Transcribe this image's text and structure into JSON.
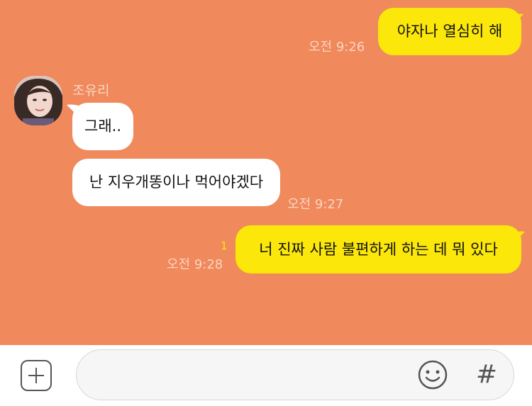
{
  "messages": [
    {
      "side": "mine",
      "text": "야자나 열심히 해",
      "time": "오전 9:26"
    },
    {
      "side": "theirs",
      "sender": "조유리",
      "text": "그래.."
    },
    {
      "side": "theirs",
      "text": "난 지우개똥이나 먹어야겠다",
      "time": "오전 9:27"
    },
    {
      "side": "mine",
      "text": "너 진짜 사람 불편하게 하는 데 뭐 있다",
      "time": "오전 9:28",
      "unread": "1"
    }
  ],
  "composer": {
    "placeholder": "",
    "value": ""
  },
  "icons": {
    "attach": "plus-box-icon",
    "emoji": "smiley-icon",
    "hashtag": "hash-icon"
  },
  "colors": {
    "chat_background": "#f0895b",
    "my_bubble": "#fce70a",
    "their_bubble": "#ffffff",
    "timestamp": "#fbd5c2",
    "unread_count": "#fce70a"
  }
}
